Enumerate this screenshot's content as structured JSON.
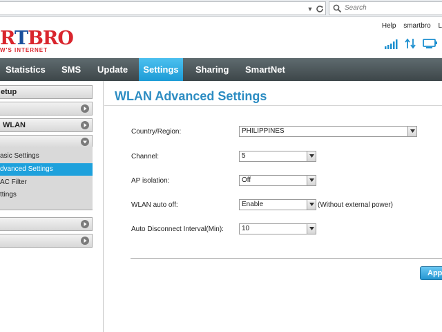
{
  "browser": {
    "search_placeholder": "Search"
  },
  "header": {
    "logo_prefix": "",
    "logo_red1": "R",
    "logo_blue": "T",
    "logo_red2": "BRO",
    "logo_tagline": "W'S INTERNET",
    "links": [
      "Help",
      "smartbro",
      "L"
    ]
  },
  "nav": {
    "items": [
      "Statistics",
      "SMS",
      "Update",
      "Settings",
      "Sharing",
      "SmartNet"
    ],
    "active": "Settings"
  },
  "sidebar": {
    "sections": [
      "etup",
      "",
      "WLAN",
      "",
      "",
      ""
    ],
    "subitems": [
      "asic Settings",
      "dvanced Settings",
      "AC Filter",
      "ttings"
    ],
    "active_subitem": "dvanced Settings"
  },
  "main": {
    "title": "WLAN Advanced Settings",
    "fields": [
      {
        "label": "Country/Region:",
        "value": "PHILIPPINES",
        "note": ""
      },
      {
        "label": "Channel:",
        "value": "5",
        "note": ""
      },
      {
        "label": "AP isolation:",
        "value": "Off",
        "note": ""
      },
      {
        "label": "WLAN auto off:",
        "value": "Enable",
        "note": "(Without external power)"
      },
      {
        "label": "Auto Disconnect Interval(Min):",
        "value": "10",
        "note": ""
      }
    ],
    "apply_label": "Appl"
  },
  "colors": {
    "accent": "#1ea1dc",
    "title": "#2c8cc2",
    "brand_red": "#d9252d",
    "brand_blue": "#1b4f9c",
    "nav_bg": "#4a5457"
  },
  "icons": {
    "signal": "signal-bars-icon",
    "data": "up-down-arrows-icon",
    "device": "monitor-icon"
  }
}
